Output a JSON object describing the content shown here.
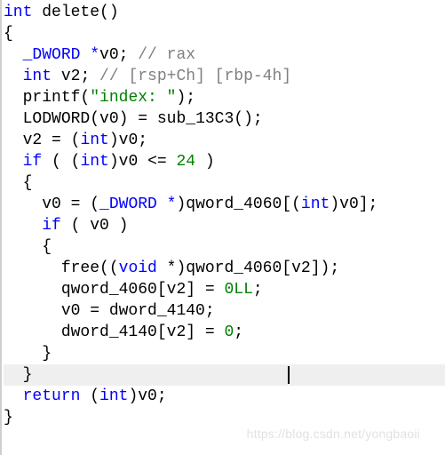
{
  "code": {
    "l1": {
      "kw1": "int",
      "sp": " ",
      "fn": "delete",
      "paren": "()"
    },
    "l2": {
      "txt": "{"
    },
    "l3": {
      "pad": "  ",
      "type": "_DWORD *",
      "var": "v0",
      "sc": "; ",
      "comm": "// rax"
    },
    "l4": {
      "pad": "  ",
      "kw": "int",
      "sp": " ",
      "var": "v2",
      "sc": "; ",
      "comm": "// [rsp+Ch] [rbp-4h]"
    },
    "l5": {
      "txt": ""
    },
    "l6": {
      "pad": "  ",
      "fn": "printf",
      "a1": "(",
      "str": "\"index: \"",
      "a2": ");"
    },
    "l7": {
      "pad": "  ",
      "mac": "LODWORD",
      "a1": "(",
      "var": "v0",
      "a2": ") = ",
      "fn": "sub_13C3",
      "a3": "();"
    },
    "l8": {
      "pad": "  ",
      "var1": "v2",
      "eq": " = (",
      "kw": "int",
      "a": ")",
      "var2": "v0",
      "sc": ";"
    },
    "l9": {
      "pad": "  ",
      "kw": "if",
      "a1": " ( (",
      "kw2": "int",
      "a2": ")",
      "var": "v0",
      "cmp": " <= ",
      "num": "24",
      "a3": " )"
    },
    "l10": {
      "pad": "  ",
      "txt": "{"
    },
    "l11": {
      "pad": "    ",
      "var": "v0",
      "eq": " = (",
      "type": "_DWORD *",
      "a": ")",
      "glob": "qword_4060",
      "b": "[(",
      "kw": "int",
      "c": ")",
      "var2": "v0",
      "d": "];"
    },
    "l12": {
      "pad": "    ",
      "kw": "if",
      "a1": " ( ",
      "var": "v0",
      "a2": " )"
    },
    "l13": {
      "pad": "    ",
      "txt": "{"
    },
    "l14": {
      "pad": "      ",
      "fn": "free",
      "a1": "((",
      "kw": "void",
      "a2": " *)",
      "glob": "qword_4060",
      "b": "[",
      "var": "v2",
      "c": "]);"
    },
    "l15": {
      "pad": "      ",
      "glob": "qword_4060",
      "a": "[",
      "var": "v2",
      "b": "] = ",
      "num": "0LL",
      "sc": ";"
    },
    "l16": {
      "pad": "      ",
      "var": "v0",
      "eq": " = ",
      "glob": "dword_4140",
      "sc": ";"
    },
    "l17": {
      "pad": "      ",
      "glob": "dword_4140",
      "a": "[",
      "var": "v2",
      "b": "] = ",
      "num": "0",
      "sc": ";"
    },
    "l18": {
      "pad": "    ",
      "txt": "}"
    },
    "l19": {
      "pad": "  ",
      "txt": "}"
    },
    "l20": {
      "pad": "  ",
      "kw": "return",
      "sp": " (",
      "kw2": "int",
      "a": ")",
      "var": "v0",
      "sc": ";"
    },
    "l21": {
      "txt": "}"
    }
  },
  "watermark": "https://blog.csdn.net/yongbaoii"
}
